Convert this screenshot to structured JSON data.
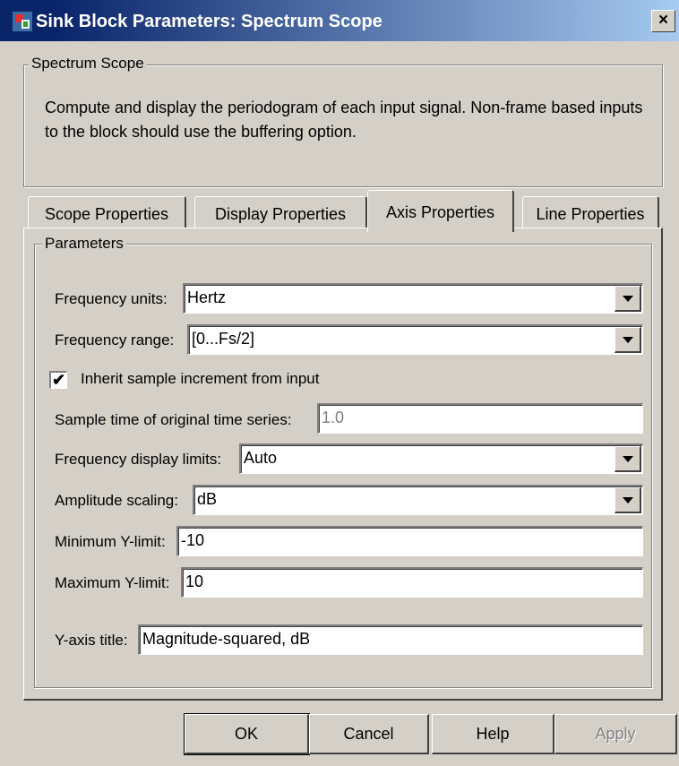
{
  "window": {
    "title": "Sink Block Parameters: Spectrum Scope",
    "close_label": "×"
  },
  "header_group": {
    "label": "Spectrum Scope",
    "description": "Compute and display the periodogram of each input signal.  Non-frame based inputs to the block should use the buffering option."
  },
  "tabs": [
    {
      "label": "Scope Properties",
      "active": false
    },
    {
      "label": "Display Properties",
      "active": false
    },
    {
      "label": "Axis Properties",
      "active": true
    },
    {
      "label": "Line Properties",
      "active": false
    }
  ],
  "parameters": {
    "group_label": "Parameters",
    "frequency_units": {
      "label": "Frequency units:",
      "value": "Hertz"
    },
    "frequency_range": {
      "label": "Frequency range:",
      "value": "[0...Fs/2]"
    },
    "inherit_sample": {
      "label": "Inherit sample increment from input",
      "checked": true,
      "mark": "✔"
    },
    "sample_time": {
      "label": "Sample time of original time series:",
      "value": "1.0"
    },
    "freq_display_limits": {
      "label": "Frequency display limits:",
      "value": "Auto"
    },
    "amplitude_scaling": {
      "label": "Amplitude scaling:",
      "value": "dB"
    },
    "min_ylimit": {
      "label": "Minimum Y-limit:",
      "value": "-10"
    },
    "max_ylimit": {
      "label": "Maximum Y-limit:",
      "value": "10"
    },
    "yaxis_title": {
      "label": "Y-axis title:",
      "value": "Magnitude-squared, dB"
    }
  },
  "buttons": {
    "ok": "OK",
    "cancel": "Cancel",
    "help": "Help",
    "apply": "Apply"
  },
  "colors": {
    "face": "#d4d0c8",
    "title_start": "#0a246a",
    "title_end": "#a6caf0"
  }
}
